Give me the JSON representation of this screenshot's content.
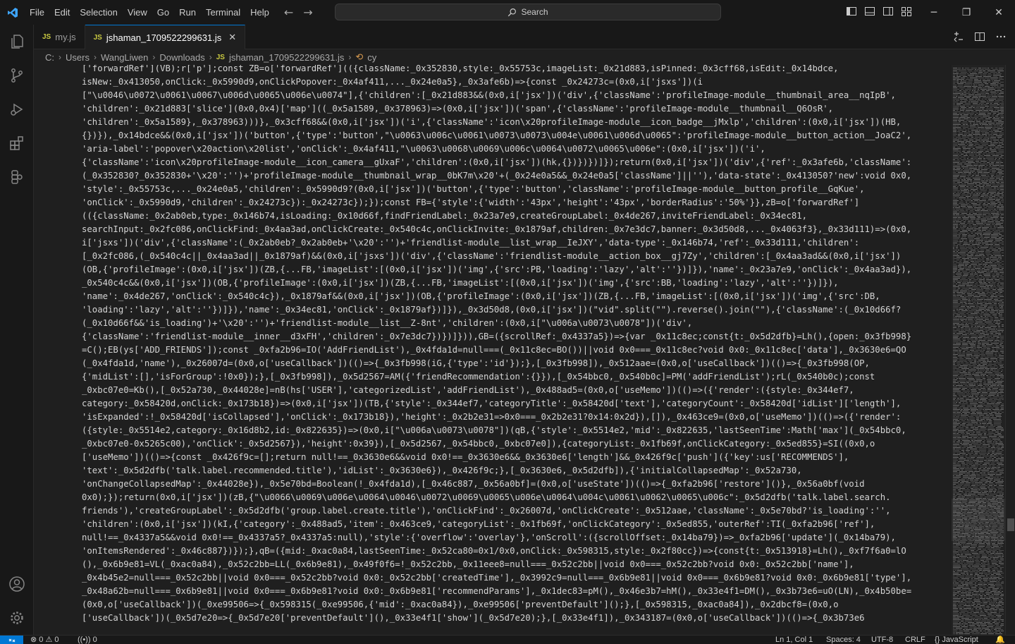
{
  "menu": [
    "File",
    "Edit",
    "Selection",
    "View",
    "Go",
    "Run",
    "Terminal",
    "Help"
  ],
  "search": {
    "placeholder": "Search"
  },
  "tabs": [
    {
      "label": "my.js",
      "active": false
    },
    {
      "label": "jshaman_1709522299631.js",
      "active": true
    }
  ],
  "breadcrumb": [
    "C:",
    "Users",
    "WangLiwen",
    "Downloads",
    "jshaman_1709522299631.js",
    "cy"
  ],
  "status": {
    "problems": "0 ⚠ 0",
    "ports": "0",
    "position": "Ln 1, Col 1",
    "spaces": "Spaces: 4",
    "encoding": "UTF-8",
    "eol": "CRLF",
    "language": "JavaScript"
  },
  "colors": {
    "accent": "#0078d4",
    "editor_bg": "#1f1f1f",
    "chrome_bg": "#181818",
    "js_badge": "#cbcb41"
  },
  "code_lines": [
    "['forwardRef'](VB);r['p'];const ZB=o['forwardRef'](({className:_0x352830,style:_0x55753c,imageList:_0x21d883,isPinned:_0x3cff68,isEdit:_0x14bdce,",
    "isNew:_0x413050,onClick:_0x5990d9,onClickPopover:_0x4af411,..._0x24e0a5},_0x3afe6b)=>{const _0x24273c=(0x0,i['jsxs'])(i",
    "[\"\\u0046\\u0072\\u0061\\u0067\\u006d\\u0065\\u006e\\u0074\"],{'children':[_0x21d883&&(0x0,i['jsx'])('div',{'className':'profileImage-module__thumbnail_area__nqIpB',",
    "'children':_0x21d883['slice'](0x0,0x4)['map']((_0x5a1589,_0x378963)=>(0x0,i['jsx'])('span',{'className':'profileImage-module__thumbnail__Q6OsR',",
    "'children':_0x5a1589},_0x378963)))},_0x3cff68&&(0x0,i['jsx'])('i',{'className':'icon\\x20profileImage-module__icon_badge__jMxlp','children':(0x0,i['jsx'])(HB,",
    "{})}),_0x14bdce&&(0x0,i['jsx'])('button',{'type':'button',\"\\u0063\\u006c\\u0061\\u0073\\u0073\\u004e\\u0061\\u006d\\u0065\":'profileImage-module__button_action__JoaC2',",
    "'aria-label':'popover\\x20action\\x20list','onClick':_0x4af411,\"\\u0063\\u0068\\u0069\\u006c\\u0064\\u0072\\u0065\\u006e\":(0x0,i['jsx'])('i',",
    "{'className':'icon\\x20profileImage-module__icon_camera__gUxaF','children':(0x0,i['jsx'])(hk,{})})})]});return(0x0,i['jsx'])('div',{'ref':_0x3afe6b,'className':",
    "(_0x352830?_0x352830+'\\x20':'')+'profileImage-module__thumbnail_wrap__0bK7m\\x20'+(_0x24e0a5&&_0x24e0a5['className']||''),'data-state':_0x413050?'new':void 0x0,",
    "'style':_0x55753c,..._0x24e0a5,'children':_0x5990d9?(0x0,i['jsx'])('button',{'type':'button','className':'profileImage-module__button_profile__GqKue',",
    "'onClick':_0x5990d9,'children':_0x24273c}):_0x24273c});});const FB={'style':{'width':'43px','height':'43px','borderRadius':'50%'}},zB=o['forwardRef']",
    "(({className:_0x2ab0eb,type:_0x146b74,isLoading:_0x10d66f,findFriendLabel:_0x23a7e9,createGroupLabel:_0x4de267,inviteFriendLabel:_0x34ec81,",
    "searchInput:_0x2fc086,onClickFind:_0x4aa3ad,onClickCreate:_0x540c4c,onClickInvite:_0x1879af,children:_0x7e3dc7,banner:_0x3d50d8,..._0x4063f3},_0x33d111)=>(0x0,",
    "i['jsxs'])('div',{'className':(_0x2ab0eb?_0x2ab0eb+'\\x20':'')+'friendlist-module__list_wrap__IeJXY','data-type':_0x146b74,'ref':_0x33d111,'children':",
    "[_0x2fc086,(_0x540c4c||_0x4aa3ad||_0x1879af)&&(0x0,i['jsxs'])('div',{'className':'friendlist-module__action_box__gj7Zy','children':[_0x4aa3ad&&(0x0,i['jsx'])",
    "(OB,{'profileImage':(0x0,i['jsx'])(ZB,{...FB,'imageList':[(0x0,i['jsx'])('img',{'src':PB,'loading':'lazy','alt':''})]}),'name':_0x23a7e9,'onClick':_0x4aa3ad}),",
    "_0x540c4c&&(0x0,i['jsx'])(OB,{'profileImage':(0x0,i['jsx'])(ZB,{...FB,'imageList':[(0x0,i['jsx'])('img',{'src':BB,'loading':'lazy','alt':''})]}),",
    "'name':_0x4de267,'onClick':_0x540c4c}),_0x1879af&&(0x0,i['jsx'])(OB,{'profileImage':(0x0,i['jsx'])(ZB,{...FB,'imageList':[(0x0,i['jsx'])('img',{'src':DB,",
    "'loading':'lazy','alt':''})]}),'name':_0x34ec81,'onClick':_0x1879af})]}),_0x3d50d8,(0x0,i['jsx'])(\"vid\".split(\"\").reverse().join(\"\"),{'className':(_0x10d66f?",
    "(_0x10d66f&&'is_loading')+'\\x20':'')+'friendlist-module__list__Z-8nt','children':(0x0,i[\"\\u006a\\u0073\\u0078\"])('div',",
    "{'className':'friendlist-module__inner__d3xFH','children':_0x7e3dc7})})]})),GB=({scrollRef:_0x4337a5})=>{var _0x11c8ec;const{t:_0x5d2dfb}=Lh(),{open:_0x3fb998}",
    "=C();EB(ys['ADD_FRIENDS']);const _0xfa2b96=IO('AddFriendList'),_0x4fda1d=null===(_0x11c8ec=BO())||void 0x0===_0x11c8ec?void 0x0:_0x11c8ec['data'],_0x3630e6=QO",
    "(_0x4fda1d,'name'),_0x26007d=(0x0,o['useCallback'])(()=>{_0x3fb998(iG,{'type':'id'});},[_0x3fb998]),_0x512aae=(0x0,o['useCallback'])(()=>{_0x3fb998(OP,",
    "{'midList':[],'isForGroup':!0x0});},[_0x3fb998]),_0x5d2567=AM({'friendRecommendation':{}}),[_0x54bbc0,_0x540b0c]=PM('addFriendList');rL(_0x540b0c);const",
    "_0xbc07e0=Kb(),[_0x52a730,_0x44028e]=nB(hs['USER'],'categorizedList','addFriendList'),_0x488ad5=(0x0,o['useMemo'])(()=>({'render':({style:_0x344ef7,",
    "category:_0x58420d,onClick:_0x173b18})=>(0x0,i['jsx'])(TB,{'style':_0x344ef7,'categoryTitle':_0x58420d['text'],'categoryCount':_0x58420d['idList']['length'],",
    "'isExpanded':!_0x58420d['isCollapsed'],'onClick':_0x173b18}),'height':_0x2b2e31=>0x0===_0x2b2e31?0x14:0x2d}),[]),_0x463ce9=(0x0,o['useMemo'])(()=>({'render':",
    "({style:_0x5514e2,category:_0x16d8b2,id:_0x822635})=>(0x0,i[\"\\u006a\\u0073\\u0078\"])(qB,{'style':_0x5514e2,'mid':_0x822635,'lastSeenTime':Math['max'](_0x54bbc0,",
    "_0xbc07e0-0x5265c00),'onClick':_0x5d2567}),'height':0x39}),[_0x5d2567,_0x54bbc0,_0xbc07e0]),{categoryList:_0x1fb69f,onClickCategory:_0x5ed855}=SI((0x0,o",
    "['useMemo'])(()=>{const _0x426f9c=[];return null!==_0x3630e6&&void 0x0!==_0x3630e6&&_0x3630e6['length']&&_0x426f9c['push']({'key':us['RECOMMENDS'],",
    "'text':_0x5d2dfb('talk.label.recommended.title'),'idList':_0x3630e6}),_0x426f9c;},[_0x3630e6,_0x5d2dfb]),{'initialCollapsedMap':_0x52a730,",
    "'onChangeCollapsedMap':_0x44028e}),_0x5e70bd=Boolean(!_0x4fda1d),[_0x46c887,_0x56a0bf]=(0x0,o['useState'])(()=>{_0xfa2b96['restore']()},_0x56a0bf(void",
    "0x0);});return(0x0,i['jsx'])(zB,{\"\\u0066\\u0069\\u006e\\u0064\\u0046\\u0072\\u0069\\u0065\\u006e\\u0064\\u004c\\u0061\\u0062\\u0065\\u006c\":_0x5d2dfb('talk.label.search.",
    "friends'),'createGroupLabel':_0x5d2dfb('group.label.create.title'),'onClickFind':_0x26007d,'onClickCreate':_0x512aae,'className':_0x5e70bd?'is_loading':'',",
    "'children':(0x0,i['jsx'])(kI,{'category':_0x488ad5,'item':_0x463ce9,'categoryList':_0x1fb69f,'onClickCategory':_0x5ed855,'outerRef':TI(_0xfa2b96['ref'],",
    "null!==_0x4337a5&&void 0x0!==_0x4337a5?_0x4337a5:null),'style':{'overflow':'overlay'},'onScroll':({scrollOffset:_0x14ba79})=>_0xfa2b96['update'](_0x14ba79),",
    "'onItemsRendered':_0x46c887})});},qB=({mid:_0xac0a84,lastSeenTime:_0x52ca80=0x1/0x0,onClick:_0x598315,style:_0x2f80cc})=>{const{t:_0x513918}=Lh(),_0xf7f6a0=lO",
    "(),_0x6b9e81=VL(_0xac0a84),_0x52c2bb=LL(_0x6b9e81),_0x49f0f6=!_0x52c2bb,_0x11eee8=null===_0x52c2bb||void 0x0===_0x52c2bb?void 0x0:_0x52c2bb['name'],",
    "_0x4b45e2=null===_0x52c2bb||void 0x0===_0x52c2bb?void 0x0:_0x52c2bb['createdTime'],_0x3992c9=null===_0x6b9e81||void 0x0===_0x6b9e81?void 0x0:_0x6b9e81['type'],",
    "_0x48a62b=null===_0x6b9e81||void 0x0===_0x6b9e81?void 0x0:_0x6b9e81['recommendParams'],_0x1dec83=pM(),_0x46e3b7=hM(),_0x33e4f1=DM(),_0x3b73e6=uO(LN),_0x4b50be=",
    "(0x0,o['useCallback'])(_0xe99506=>{_0x598315(_0xe99506,{'mid':_0xac0a84}),_0xe99506['preventDefault']();},[_0x598315,_0xac0a84]),_0x2dbcf8=(0x0,o",
    "['useCallback'])(_0x5d7e20=>{_0x5d7e20['preventDefault'](),_0x33e4f1['show'](_0x5d7e20);},[_0x33e4f1]),_0x343187=(0x0,o['useCallback'])(()=>{_0x3b73e6"
  ]
}
